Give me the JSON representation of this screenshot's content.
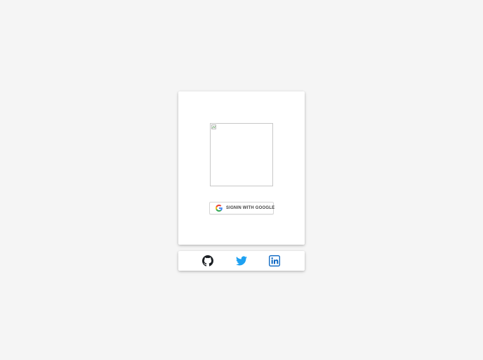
{
  "login": {
    "google_button_label": "SIGNIN WITH GOOGLE"
  },
  "icons": {
    "logo": "broken-image-icon",
    "google": "google-icon",
    "github": "github-icon",
    "twitter": "twitter-icon",
    "linkedin": "linkedin-icon"
  },
  "colors": {
    "page_background": "#f5f5f5",
    "card_background": "#ffffff",
    "github": "#1b1f23",
    "twitter": "#1da1f2",
    "linkedin": "#0a66c2",
    "google_blue": "#4285f4",
    "google_red": "#ea4335",
    "google_yellow": "#fbbc05",
    "google_green": "#34a853"
  }
}
